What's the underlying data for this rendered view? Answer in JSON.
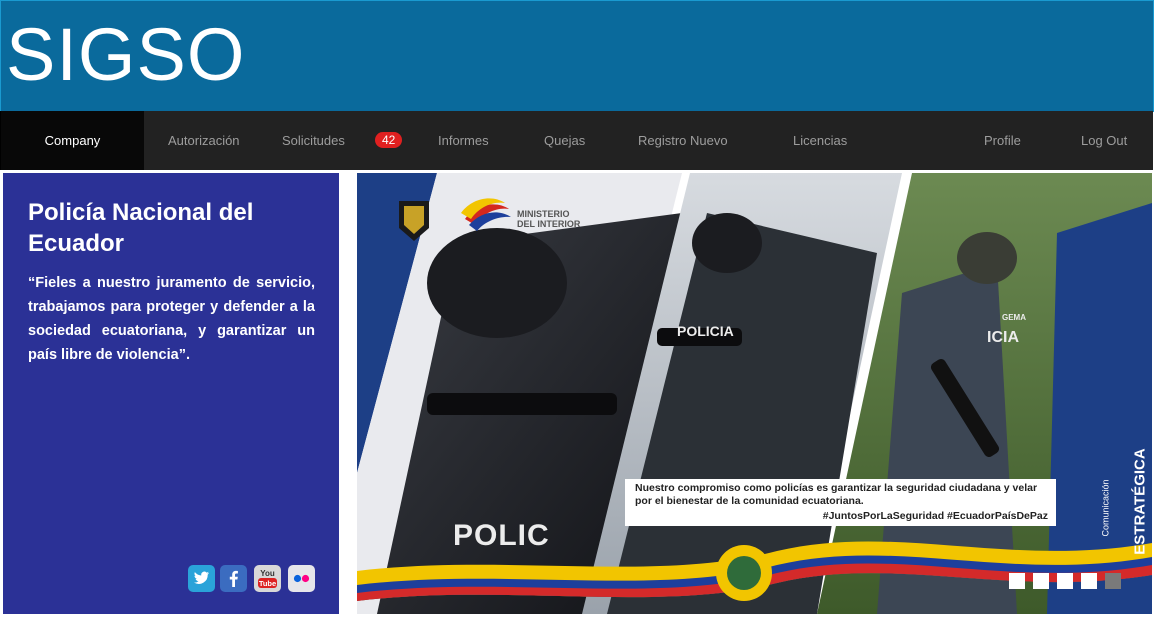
{
  "header": {
    "title": "SIGSO"
  },
  "nav": {
    "company": "Company",
    "items": [
      "Autorización",
      "Solicitudes",
      "Informes",
      "Quejas",
      "Registro Nuevo",
      "Licencias"
    ],
    "badge_count": "42",
    "profile": "Profile",
    "logout": "Log Out"
  },
  "side": {
    "title": "Policía Nacional del Ecuador",
    "text": "“Fieles a nuestro juramento de servicio, trabajamos para proteger y defender a la sociedad ecuatoriana, y garantizar un país libre de violencia”.",
    "social_icons": [
      "twitter-icon",
      "facebook-icon",
      "youtube-icon",
      "flickr-icon"
    ],
    "youtube_label": "You Tube"
  },
  "banner": {
    "ministry_line1": "MINISTERIO",
    "ministry_line2": "DEL INTERIOR",
    "vest_label_1": "POLICIA",
    "vest_label_2": "ICIA",
    "vest_label_3": "POLIC",
    "vest_label_4": "GEMA",
    "caption": "Nuestro compromiso como policías es garantizar la seguridad ciudadana y velar por el bienestar de la comunidad ecuatoriana.",
    "hashtags": "#JuntosPorLaSeguridad #EcuadorPaísDePaz",
    "comm_line1": "Comunicación",
    "comm_line2": "ESTRATÉGICA",
    "slides": 5,
    "active_slide": 5
  },
  "colors": {
    "header": "#0a6a9c",
    "nav": "#222222",
    "panel": "#2b3196",
    "badge": "#e02020"
  }
}
